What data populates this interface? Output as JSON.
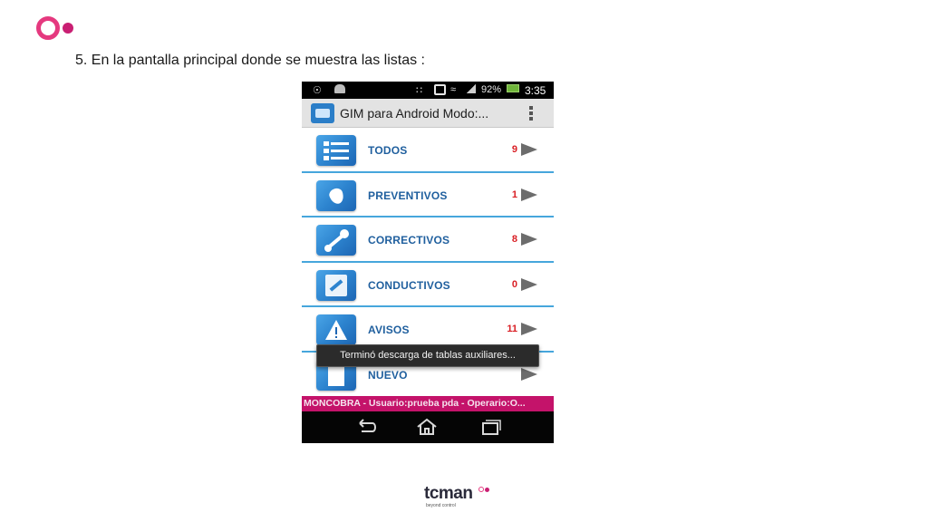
{
  "slide": {
    "title": "5.  En la pantalla principal donde se muestra las listas :"
  },
  "statusbar": {
    "battery_percent": "92%",
    "time": "3:35"
  },
  "app": {
    "title": "GIM para Android Modo:..."
  },
  "list": {
    "items": [
      {
        "label": "TODOS",
        "count": "9",
        "icon": "list-icon"
      },
      {
        "label": "PREVENTIVOS",
        "count": "1",
        "icon": "drop-icon"
      },
      {
        "label": "CORRECTIVOS",
        "count": "8",
        "icon": "wrench-icon"
      },
      {
        "label": "CONDUCTIVOS",
        "count": "0",
        "icon": "tools-icon"
      },
      {
        "label": "AVISOS",
        "count": "11",
        "icon": "warning-icon"
      },
      {
        "label": "NUEVO",
        "count": "",
        "icon": "new-document-icon"
      }
    ]
  },
  "toast": {
    "message": "Terminó descarga de tablas auxiliares..."
  },
  "footer": {
    "text": "MONCOBRA  -  Usuario:prueba pda  -  Operario:O..."
  },
  "brand": {
    "name": "tcman",
    "tagline": "beyond control"
  },
  "colors": {
    "accent": "#e5397f",
    "footer_bar": "#c4136a",
    "divider": "#46a6dc",
    "label": "#1f5f9e",
    "count": "#d91f25"
  }
}
